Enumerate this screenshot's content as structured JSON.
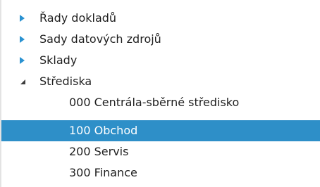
{
  "tree": {
    "nodes": [
      {
        "label": "Řady dokladů",
        "state": "collapsed"
      },
      {
        "label": "Sady datových zdrojů",
        "state": "collapsed"
      },
      {
        "label": "Sklady",
        "state": "collapsed"
      },
      {
        "label": "Střediska",
        "state": "expanded",
        "children": [
          {
            "label": "000 Centrála-sběrné středisko",
            "selected": false
          },
          {
            "label": "100 Obchod",
            "selected": true
          },
          {
            "label": "200 Servis",
            "selected": false
          },
          {
            "label": "300 Finance",
            "selected": false
          }
        ]
      }
    ],
    "colors": {
      "toggle_collapsed": "#2a92d1",
      "toggle_expanded": "#3d3d3d",
      "selection_bg": "#2e8fc8",
      "selection_text": "#ffffff"
    }
  }
}
